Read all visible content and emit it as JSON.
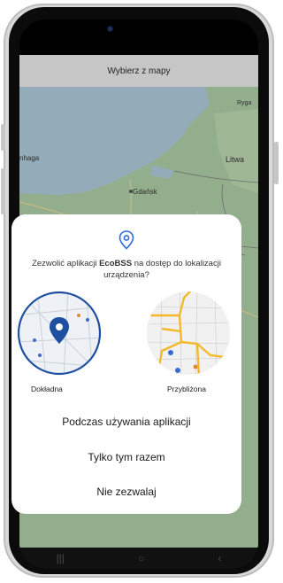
{
  "app": {
    "title": "Wybierz z mapy"
  },
  "map": {
    "labels": {
      "litwa": "Litwa",
      "gdansk": "Gdańsk",
      "hagen": "nhaga",
      "ryga": "Ryga"
    }
  },
  "dialog": {
    "prompt_before": "Zezwolić aplikacji ",
    "app_name": "EcoBSS",
    "prompt_after": " na dostęp do lokalizacji urządzenia?",
    "precise_label": "Dokładna",
    "approx_label": "Przybliżona",
    "actions": {
      "while_using": "Podczas używania aplikacji",
      "only_this_time": "Tylko tym razem",
      "deny": "Nie zezwalaj"
    }
  },
  "navbar": {
    "recent_glyph": "|||",
    "home_glyph": "○",
    "back_glyph": "‹"
  },
  "colors": {
    "accent": "#1f4fa0",
    "map_water": "#a9c3d4",
    "map_land": "#a8c7a0",
    "dialog_bg": "#ffffff"
  }
}
